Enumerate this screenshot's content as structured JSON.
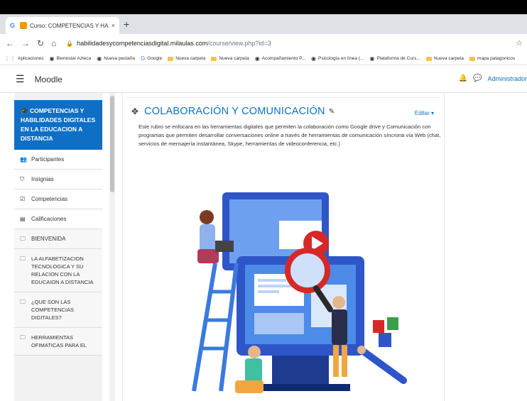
{
  "browser": {
    "tab_title": "Curso: COMPETENCIAS Y HABILI",
    "tab_close": "×",
    "new_tab": "+",
    "url_host": "habilidadesycompetenciasdigital.milaulas.com",
    "url_path": "/course/view.php?id=3",
    "bookmarks": [
      {
        "label": "Aplicaciones",
        "icon": "apps-icon"
      },
      {
        "label": "Bienestar Azteca",
        "icon": "globe-icon"
      },
      {
        "label": "Nueva pestaña",
        "icon": "globe-icon"
      },
      {
        "label": "Google",
        "icon": "google-icon"
      },
      {
        "label": "Nueva carpeta",
        "icon": "folder-icon"
      },
      {
        "label": "Nueva carpeta",
        "icon": "folder-icon"
      },
      {
        "label": "Acompañamiento P...",
        "icon": "globe-icon"
      },
      {
        "label": "Psicología en línea (...",
        "icon": "globe-icon"
      },
      {
        "label": "Plataforma de Curs...",
        "icon": "globe-icon"
      },
      {
        "label": "Nueva carpeta",
        "icon": "folder-icon"
      },
      {
        "label": "mapa patagonicos",
        "icon": "folder-icon"
      }
    ]
  },
  "navbar": {
    "brand": "Moodle",
    "user": "Administrador"
  },
  "drawer": {
    "active_course": "COMPETENCIAS Y HABILIDADES DIGITALES EN LA EDUCACION A DISTANCIA",
    "items": [
      {
        "label": "Participantes",
        "icon": "users-icon"
      },
      {
        "label": "Insignias",
        "icon": "shield-icon"
      },
      {
        "label": "Competencias",
        "icon": "check-square-icon"
      },
      {
        "label": "Calificaciones",
        "icon": "table-icon"
      },
      {
        "label": "BIENVENIDA",
        "icon": "folder-icon"
      },
      {
        "label": "LA ALFABETIZACION TECNOLOGICA Y SU RELACION CON LA EDUCAION A DISTANCIA",
        "icon": "folder-icon"
      },
      {
        "label": "¿QUE SON LAS COMPETENCIAS DIGITALES?",
        "icon": "folder-icon"
      },
      {
        "label": "HERRAMIENTAS OFIMATICAS PARA EL",
        "icon": "folder-icon"
      }
    ]
  },
  "section": {
    "title": "COLABORACIÓN Y COMUNICACIÓN",
    "edit_label": "Editar ▾",
    "description": "Este rubro se enfocara en las herramientas digitales que permiten la colaboración como Google drive y Comunicación con programas que permiten desarrollar conversaciones online a través de herramientas de comunicación síncrona vía Web (chat, servicios de mensajería instantánea, Skype, herramientas de videoconferencia, etc.)"
  },
  "colors": {
    "accent": "#0f6fc5",
    "drawer_bg": "#f2f2f2",
    "illus_blue": "#2f56c8",
    "illus_light": "#4c8be8",
    "illus_red": "#d62828"
  }
}
